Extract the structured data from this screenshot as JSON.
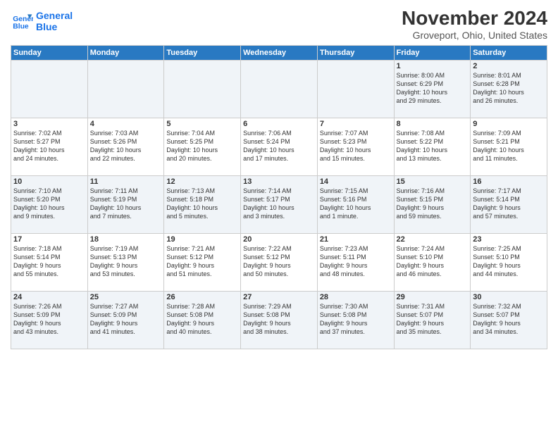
{
  "header": {
    "logo_line1": "General",
    "logo_line2": "Blue",
    "title": "November 2024",
    "subtitle": "Groveport, Ohio, United States"
  },
  "weekdays": [
    "Sunday",
    "Monday",
    "Tuesday",
    "Wednesday",
    "Thursday",
    "Friday",
    "Saturday"
  ],
  "weeks": [
    [
      {
        "day": "",
        "info": ""
      },
      {
        "day": "",
        "info": ""
      },
      {
        "day": "",
        "info": ""
      },
      {
        "day": "",
        "info": ""
      },
      {
        "day": "",
        "info": ""
      },
      {
        "day": "1",
        "info": "Sunrise: 8:00 AM\nSunset: 6:29 PM\nDaylight: 10 hours\nand 29 minutes."
      },
      {
        "day": "2",
        "info": "Sunrise: 8:01 AM\nSunset: 6:28 PM\nDaylight: 10 hours\nand 26 minutes."
      }
    ],
    [
      {
        "day": "3",
        "info": "Sunrise: 7:02 AM\nSunset: 5:27 PM\nDaylight: 10 hours\nand 24 minutes."
      },
      {
        "day": "4",
        "info": "Sunrise: 7:03 AM\nSunset: 5:26 PM\nDaylight: 10 hours\nand 22 minutes."
      },
      {
        "day": "5",
        "info": "Sunrise: 7:04 AM\nSunset: 5:25 PM\nDaylight: 10 hours\nand 20 minutes."
      },
      {
        "day": "6",
        "info": "Sunrise: 7:06 AM\nSunset: 5:24 PM\nDaylight: 10 hours\nand 17 minutes."
      },
      {
        "day": "7",
        "info": "Sunrise: 7:07 AM\nSunset: 5:23 PM\nDaylight: 10 hours\nand 15 minutes."
      },
      {
        "day": "8",
        "info": "Sunrise: 7:08 AM\nSunset: 5:22 PM\nDaylight: 10 hours\nand 13 minutes."
      },
      {
        "day": "9",
        "info": "Sunrise: 7:09 AM\nSunset: 5:21 PM\nDaylight: 10 hours\nand 11 minutes."
      }
    ],
    [
      {
        "day": "10",
        "info": "Sunrise: 7:10 AM\nSunset: 5:20 PM\nDaylight: 10 hours\nand 9 minutes."
      },
      {
        "day": "11",
        "info": "Sunrise: 7:11 AM\nSunset: 5:19 PM\nDaylight: 10 hours\nand 7 minutes."
      },
      {
        "day": "12",
        "info": "Sunrise: 7:13 AM\nSunset: 5:18 PM\nDaylight: 10 hours\nand 5 minutes."
      },
      {
        "day": "13",
        "info": "Sunrise: 7:14 AM\nSunset: 5:17 PM\nDaylight: 10 hours\nand 3 minutes."
      },
      {
        "day": "14",
        "info": "Sunrise: 7:15 AM\nSunset: 5:16 PM\nDaylight: 10 hours\nand 1 minute."
      },
      {
        "day": "15",
        "info": "Sunrise: 7:16 AM\nSunset: 5:15 PM\nDaylight: 9 hours\nand 59 minutes."
      },
      {
        "day": "16",
        "info": "Sunrise: 7:17 AM\nSunset: 5:14 PM\nDaylight: 9 hours\nand 57 minutes."
      }
    ],
    [
      {
        "day": "17",
        "info": "Sunrise: 7:18 AM\nSunset: 5:14 PM\nDaylight: 9 hours\nand 55 minutes."
      },
      {
        "day": "18",
        "info": "Sunrise: 7:19 AM\nSunset: 5:13 PM\nDaylight: 9 hours\nand 53 minutes."
      },
      {
        "day": "19",
        "info": "Sunrise: 7:21 AM\nSunset: 5:12 PM\nDaylight: 9 hours\nand 51 minutes."
      },
      {
        "day": "20",
        "info": "Sunrise: 7:22 AM\nSunset: 5:12 PM\nDaylight: 9 hours\nand 50 minutes."
      },
      {
        "day": "21",
        "info": "Sunrise: 7:23 AM\nSunset: 5:11 PM\nDaylight: 9 hours\nand 48 minutes."
      },
      {
        "day": "22",
        "info": "Sunrise: 7:24 AM\nSunset: 5:10 PM\nDaylight: 9 hours\nand 46 minutes."
      },
      {
        "day": "23",
        "info": "Sunrise: 7:25 AM\nSunset: 5:10 PM\nDaylight: 9 hours\nand 44 minutes."
      }
    ],
    [
      {
        "day": "24",
        "info": "Sunrise: 7:26 AM\nSunset: 5:09 PM\nDaylight: 9 hours\nand 43 minutes."
      },
      {
        "day": "25",
        "info": "Sunrise: 7:27 AM\nSunset: 5:09 PM\nDaylight: 9 hours\nand 41 minutes."
      },
      {
        "day": "26",
        "info": "Sunrise: 7:28 AM\nSunset: 5:08 PM\nDaylight: 9 hours\nand 40 minutes."
      },
      {
        "day": "27",
        "info": "Sunrise: 7:29 AM\nSunset: 5:08 PM\nDaylight: 9 hours\nand 38 minutes."
      },
      {
        "day": "28",
        "info": "Sunrise: 7:30 AM\nSunset: 5:08 PM\nDaylight: 9 hours\nand 37 minutes."
      },
      {
        "day": "29",
        "info": "Sunrise: 7:31 AM\nSunset: 5:07 PM\nDaylight: 9 hours\nand 35 minutes."
      },
      {
        "day": "30",
        "info": "Sunrise: 7:32 AM\nSunset: 5:07 PM\nDaylight: 9 hours\nand 34 minutes."
      }
    ]
  ]
}
